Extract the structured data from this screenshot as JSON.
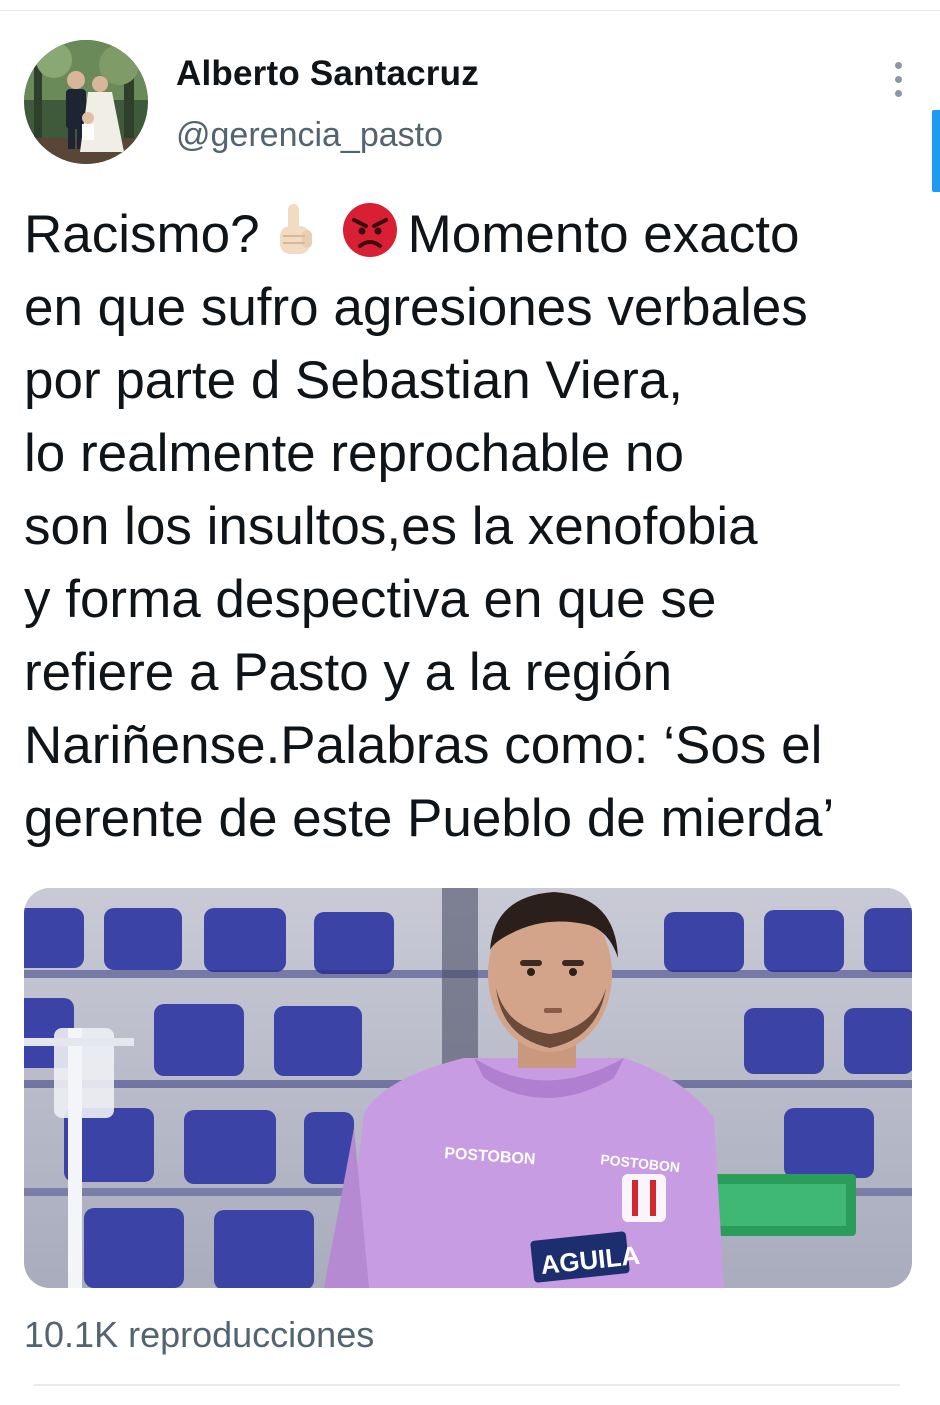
{
  "author": {
    "name": "Alberto Santacruz",
    "handle": "@gerencia_pasto"
  },
  "tweet": {
    "lines": [
      {
        "before": "Racismo?",
        "after": "Momento exacto"
      },
      "en que sufro agresiones verbales",
      "por parte d Sebastian Viera,",
      "lo realmente reprochable no",
      "son los insultos,es la xenofobia",
      "y forma despectiva en que se",
      "refiere a Pasto y a la región",
      "Nariñense.Palabras como: ‘Sos el",
      "gerente de este Pueblo de mierda’"
    ],
    "emojis": [
      "pointing-up-emoji",
      "angry-face-emoji"
    ]
  },
  "media": {
    "jersey_texts": [
      "POSTOBON",
      "POSTOBON",
      "AGUILA"
    ],
    "description_icon": "video-thumbnail"
  },
  "stats": {
    "views": "10.1K reproducciones"
  },
  "colors": {
    "accent": "#1d9bf0",
    "secondary_text": "#536471",
    "jersey": "#c79ce3",
    "seats": "#3c43a6"
  }
}
